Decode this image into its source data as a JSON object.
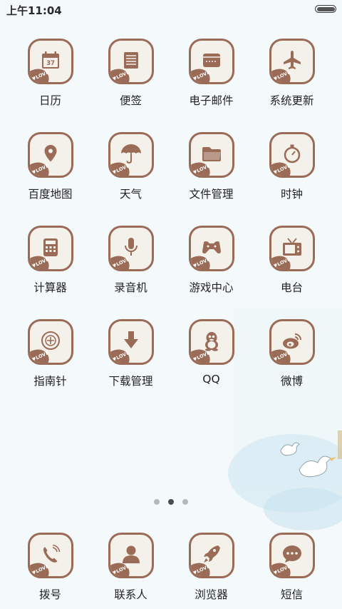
{
  "status_bar": {
    "time": "上午11:04",
    "battery_level": 1.0
  },
  "apps": [
    {
      "label": "日历",
      "icon": "calendar-icon",
      "badge": "LOVE",
      "glyph_text": "37"
    },
    {
      "label": "便签",
      "icon": "notes-icon",
      "badge": "LOVE"
    },
    {
      "label": "电子邮件",
      "icon": "email-icon",
      "badge": "LOVE"
    },
    {
      "label": "系统更新",
      "icon": "airplane-icon",
      "badge": "LOVE"
    },
    {
      "label": "百度地图",
      "icon": "map-pin-icon",
      "badge": "LOVE"
    },
    {
      "label": "天气",
      "icon": "umbrella-icon",
      "badge": "LOVE"
    },
    {
      "label": "文件管理",
      "icon": "folder-icon",
      "badge": "LOVE"
    },
    {
      "label": "时钟",
      "icon": "stopwatch-icon",
      "badge": "LOVE"
    },
    {
      "label": "计算器",
      "icon": "calculator-icon",
      "badge": "LOVE"
    },
    {
      "label": "录音机",
      "icon": "microphone-icon",
      "badge": "LOVE"
    },
    {
      "label": "游戏中心",
      "icon": "gamepad-icon",
      "badge": "LOVE"
    },
    {
      "label": "电台",
      "icon": "radio-icon",
      "badge": "LOVE"
    },
    {
      "label": "指南针",
      "icon": "compass-icon",
      "badge": "LOVE"
    },
    {
      "label": "下载管理",
      "icon": "download-icon",
      "badge": "LOVE"
    },
    {
      "label": "QQ",
      "icon": "qq-penguin-icon",
      "badge": "LOVE"
    },
    {
      "label": "微博",
      "icon": "weibo-icon",
      "badge": "LOVE"
    }
  ],
  "page_indicator": {
    "count": 3,
    "active": 2
  },
  "dock": [
    {
      "label": "拨号",
      "icon": "phone-icon",
      "badge": "LOVE"
    },
    {
      "label": "联系人",
      "icon": "contact-icon",
      "badge": "LOVE"
    },
    {
      "label": "浏览器",
      "icon": "rocket-icon",
      "badge": "LOVE"
    },
    {
      "label": "短信",
      "icon": "message-bubble-icon",
      "badge": "LOVE"
    }
  ],
  "colors": {
    "icon_brown": "#9a6b56",
    "icon_fill": "#f4f0ea",
    "background": "#f4fafc"
  }
}
